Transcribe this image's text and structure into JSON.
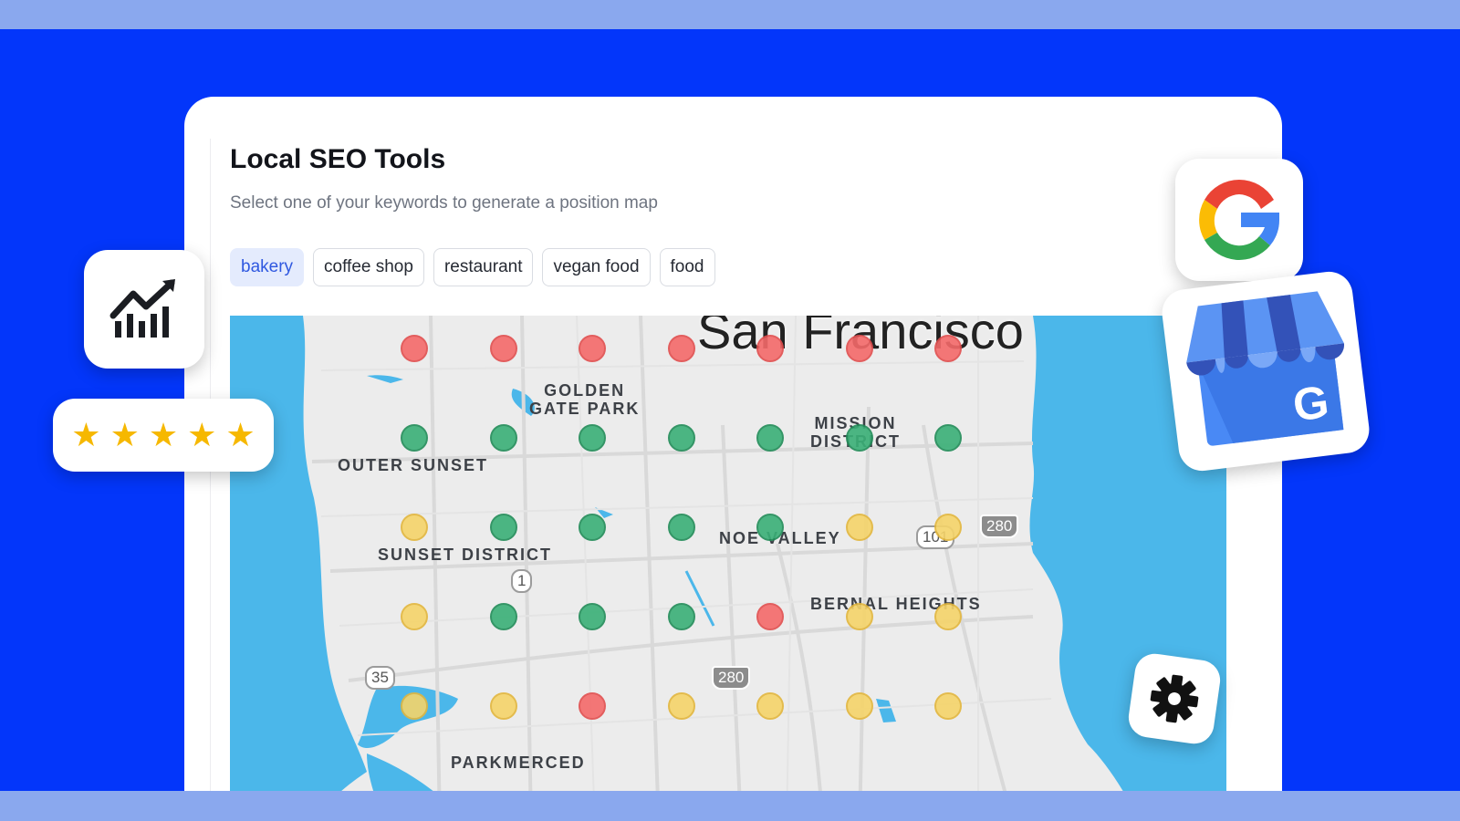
{
  "panel": {
    "title": "Local SEO Tools",
    "subtitle": "Select one of your keywords to generate a position map"
  },
  "keywords": [
    {
      "label": "bakery",
      "active": true
    },
    {
      "label": "coffee shop",
      "active": false
    },
    {
      "label": "restaurant",
      "active": false
    },
    {
      "label": "vegan food",
      "active": false
    },
    {
      "label": "food",
      "active": false
    }
  ],
  "map": {
    "city": "San Francisco",
    "places": {
      "golden_gate_park_1": "GOLDEN",
      "golden_gate_park_2": "GATE PARK",
      "mission_1": "MISSION",
      "mission_2": "DISTRICT",
      "outer_sunset": "OUTER SUNSET",
      "sunset_district": "SUNSET DISTRICT",
      "noe_valley": "NOE VALLEY",
      "bernal_heights": "BERNAL HEIGHTS",
      "parkmerced": "PARKMERCED"
    },
    "route_shields": [
      "1",
      "35",
      "101",
      "280",
      "280"
    ],
    "position_grid": [
      [
        "red",
        "red",
        "red",
        "red",
        "red",
        "red",
        "red"
      ],
      [
        "green",
        "green",
        "green",
        "green",
        "green",
        "green",
        "green"
      ],
      [
        "yellow",
        "green",
        "green",
        "green",
        "green",
        "yellow",
        "yellow"
      ],
      [
        "yellow",
        "green",
        "green",
        "green",
        "red",
        "yellow",
        "yellow"
      ],
      [
        "yellow",
        "yellow",
        "red",
        "yellow",
        "yellow",
        "yellow",
        "yellow"
      ]
    ]
  },
  "colors": {
    "background": "#0336fa",
    "rank_good": "#3ab077",
    "rank_mid": "#f5d46a",
    "rank_poor": "#f46a6a",
    "active_chip": "#2f58e0",
    "water": "#4bb7ea"
  },
  "badges": {
    "rating_stars": 5,
    "icons": [
      "growth-chart-icon",
      "google-logo-icon",
      "google-business-profile-icon",
      "gear-icon",
      "star-icon"
    ]
  }
}
